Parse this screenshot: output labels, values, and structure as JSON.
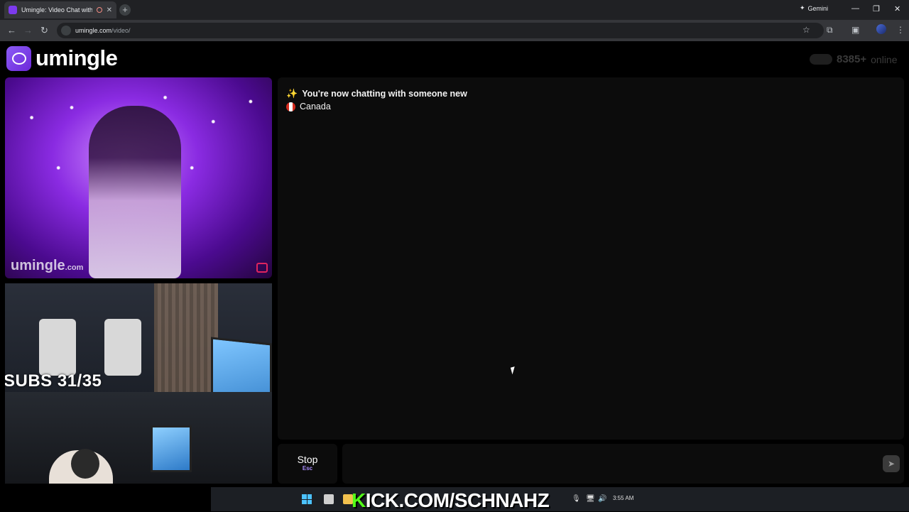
{
  "browser": {
    "tab_title": "Umingle: Video Chat with S",
    "tab_close": "✕",
    "new_tab": "+",
    "gemini_label": "Gemini",
    "url_host": "umingle.com",
    "url_path": "/video/",
    "window_controls": {
      "minimize": "—",
      "restore": "❐",
      "close": "✕"
    },
    "nav": {
      "back": "←",
      "forward": "→",
      "reload": "↻"
    },
    "toolbar": {
      "bookmark": "☆",
      "extensions": "⧉",
      "sidepanel": "▣",
      "menu": "⋮"
    }
  },
  "site": {
    "logo_text": "umingle",
    "online_count": "8385+",
    "online_label": "online"
  },
  "partner_video": {
    "watermark": "umingle",
    "watermark_suffix": ".com"
  },
  "stream_overlay": {
    "subs_text": "SUBS 31/35"
  },
  "chat": {
    "status_icon": "✨",
    "status_message": "You're now chatting with someone new",
    "country": "Canada",
    "message_placeholder": "",
    "send_icon": "➤"
  },
  "controls": {
    "stop_label": "Stop",
    "stop_key": "Esc"
  },
  "taskbar": {
    "kick_k": "K",
    "kick_rest": "ICK.COM/SCHNAHZ",
    "clock": "3:55 AM",
    "mic_icon": "🎙",
    "volume_icon": "🔊",
    "network_icon": "🖥"
  },
  "colors": {
    "accent": "#7c3aed",
    "kick_green": "#53fc18",
    "canada_red": "#d52b1e"
  }
}
